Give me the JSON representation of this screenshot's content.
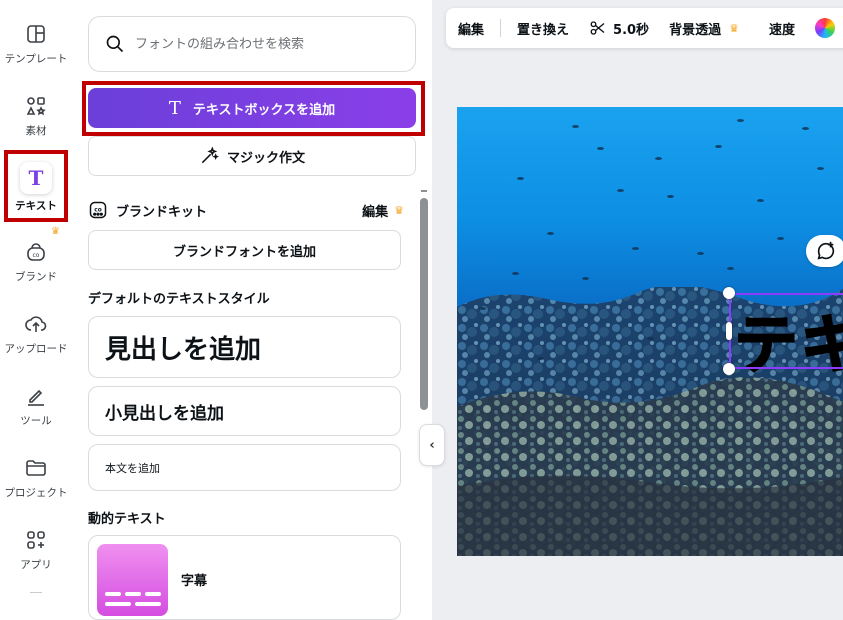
{
  "rail": {
    "items": [
      {
        "label": "テンプレート",
        "icon": "template-icon"
      },
      {
        "label": "素材",
        "icon": "elements-icon"
      },
      {
        "label": "テキスト",
        "icon": "text-icon",
        "active": true
      },
      {
        "label": "ブランド",
        "icon": "brand-icon"
      },
      {
        "label": "アップロード",
        "icon": "upload-icon"
      },
      {
        "label": "ツール",
        "icon": "tools-icon"
      },
      {
        "label": "プロジェクト",
        "icon": "folder-icon"
      },
      {
        "label": "アプリ",
        "icon": "apps-icon"
      }
    ]
  },
  "panel": {
    "search_placeholder": "フォントの組み合わせを検索",
    "add_textbox_label": "テキストボックスを追加",
    "magic_write_label": "マジック作文",
    "brand_kit_title": "ブランドキット",
    "brand_kit_edit": "編集",
    "add_brand_font_label": "ブランドフォントを追加",
    "default_styles_title": "デフォルトのテキストスタイル",
    "add_heading_label": "見出しを追加",
    "add_subheading_label": "小見出しを追加",
    "add_body_label": "本文を追加",
    "dynamic_text_title": "動的テキスト",
    "caption_label": "字幕"
  },
  "toolbar": {
    "edit": "編集",
    "replace": "置き換え",
    "duration": "5.0秒",
    "bg_remove": "背景透過",
    "speed": "速度"
  },
  "canvas": {
    "text_content": "テキ"
  },
  "colors": {
    "accent": "#8b3dff",
    "highlight": "#c00000",
    "crown": "#f5a623"
  }
}
